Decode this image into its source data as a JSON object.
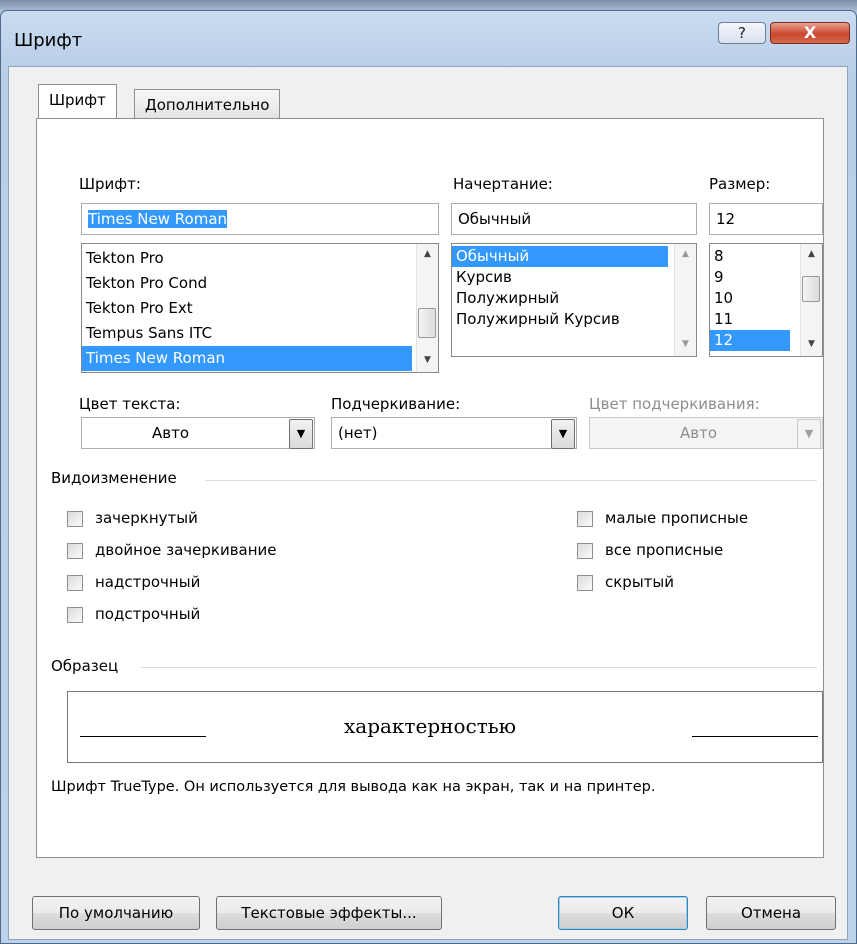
{
  "window": {
    "title": "Шрифт",
    "help_glyph": "?",
    "close_glyph": "X"
  },
  "tabs": [
    {
      "label": "Шрифт",
      "active": true
    },
    {
      "label": "Дополнительно",
      "active": false
    }
  ],
  "font": {
    "label": "Шрифт:",
    "value": "Times New Roman",
    "items": [
      "Tekton Pro",
      "Tekton Pro Cond",
      "Tekton Pro Ext",
      "Tempus Sans ITC",
      "Times New Roman"
    ],
    "selected": "Times New Roman"
  },
  "style": {
    "label": "Начертание:",
    "value": "Обычный",
    "items": [
      "Обычный",
      "Курсив",
      "Полужирный",
      "Полужирный Курсив"
    ],
    "selected": "Обычный"
  },
  "size": {
    "label": "Размер:",
    "value": "12",
    "items": [
      "8",
      "9",
      "10",
      "11",
      "12"
    ],
    "selected": "12"
  },
  "text_color": {
    "label": "Цвет текста:",
    "value": "Авто"
  },
  "underline": {
    "label": "Подчеркивание:",
    "value": "(нет)"
  },
  "underline_color": {
    "label": "Цвет подчеркивания:",
    "value": "Авто"
  },
  "effects": {
    "heading": "Видоизменение",
    "left": [
      {
        "label": "зачеркнутый",
        "checked": false
      },
      {
        "label": "двойное зачеркивание",
        "checked": false
      },
      {
        "label": "надстрочный",
        "checked": false
      },
      {
        "label": "подстрочный",
        "checked": false
      }
    ],
    "right": [
      {
        "label": "малые прописные",
        "checked": false
      },
      {
        "label": "все прописные",
        "checked": false
      },
      {
        "label": "скрытый",
        "checked": false
      }
    ]
  },
  "sample": {
    "heading": "Образец",
    "text": "характерностью",
    "description": "Шрифт TrueType. Он используется для вывода как на экран, так и на принтер."
  },
  "buttons": {
    "default": "По умолчанию",
    "text_effects": "Текстовые эффекты...",
    "ok": "ОК",
    "cancel": "Отмена"
  }
}
